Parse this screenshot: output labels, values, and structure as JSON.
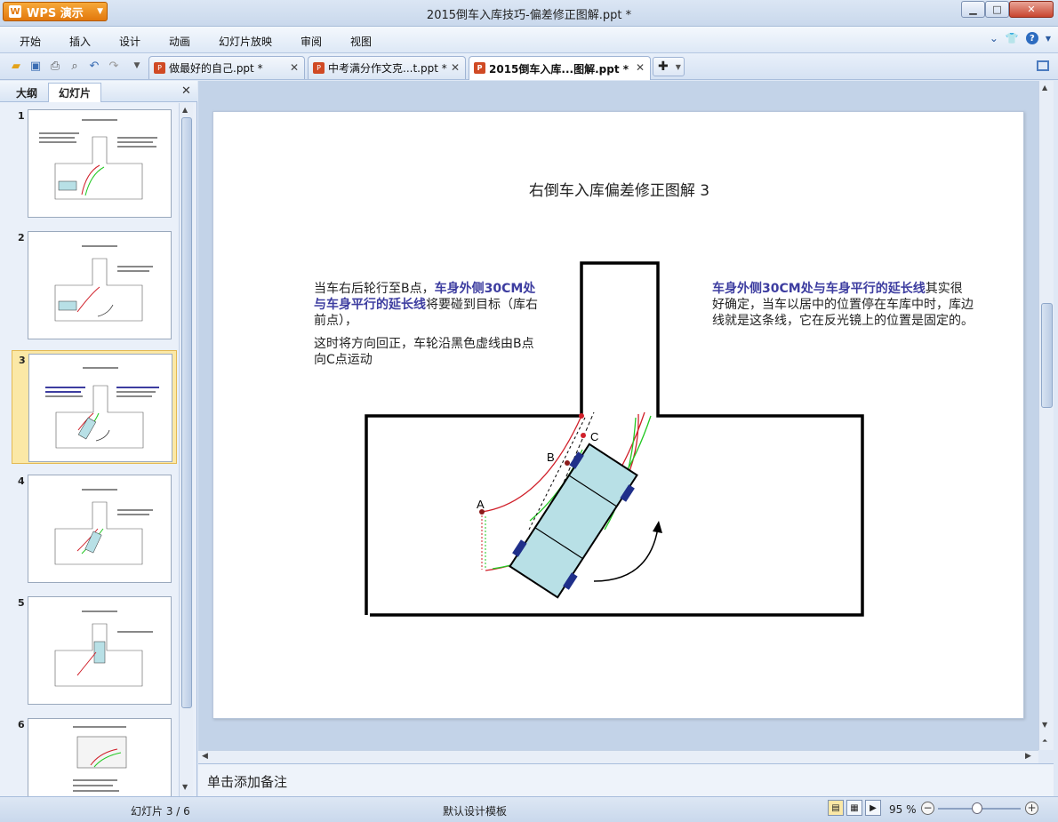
{
  "app": {
    "logo_label": "WPS 演示",
    "window_title": "2015倒车入库技巧-偏差修正图解.ppt *"
  },
  "menu": {
    "items": [
      "开始",
      "插入",
      "设计",
      "动画",
      "幻灯片放映",
      "审阅",
      "视图"
    ]
  },
  "tabs": [
    {
      "label": "做最好的自己.ppt *",
      "active": false
    },
    {
      "label": "中考满分作文克...t.ppt *",
      "active": false
    },
    {
      "label": "2015倒车入库...图解.ppt *",
      "active": true
    }
  ],
  "panel": {
    "tab_outline": "大纲",
    "tab_slides": "幻灯片",
    "slide_numbers": [
      "1",
      "2",
      "3",
      "4",
      "5",
      "6"
    ],
    "active_slide": 3
  },
  "slide": {
    "title": "右倒车入库偏差修正图解 3",
    "left_para1_normal": "当车右后轮行至B点，",
    "left_para1_highlight": "车身外侧30CM处与车身平行的延长线",
    "left_para1_tail": "将要碰到目标（库右前点），",
    "left_para2": "这时将方向回正，车轮沿黑色虚线由B点向C点运动",
    "right_highlight": "车身外侧30CM处与车身平行的延长线",
    "right_tail": "其实很好确定，当车以居中的位置停在车库中时，库边线就是这条线，它在反光镜上的位置是固定的。",
    "label_a": "A",
    "label_b": "B",
    "label_c": "C"
  },
  "notes": {
    "placeholder": "单击添加备注"
  },
  "status": {
    "slide_counter": "幻灯片 3 / 6",
    "template": "默认设计模板",
    "zoom": "95 %"
  },
  "colors": {
    "highlight_text": "#3d3da0",
    "car_fill": "#b8e0e6",
    "red_track": "#d0202a",
    "green_track": "#22c822",
    "wheel": "#1f2f8a"
  }
}
